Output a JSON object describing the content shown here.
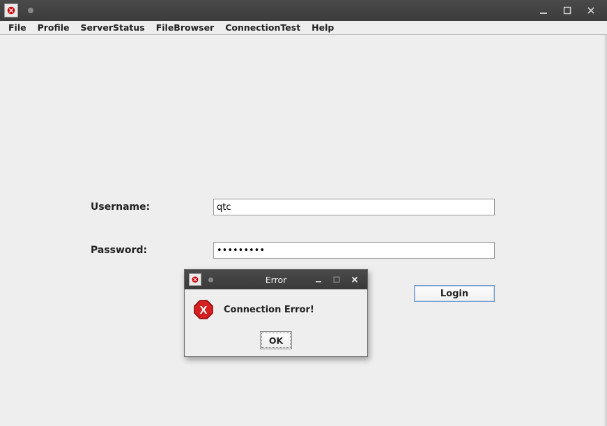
{
  "window": {
    "title": ""
  },
  "menubar": {
    "items": [
      "File",
      "Profile",
      "ServerStatus",
      "FileBrowser",
      "ConnectionTest",
      "Help"
    ]
  },
  "login": {
    "username_label": "Username:",
    "password_label": "Password:",
    "username_value": "qtc",
    "password_value": "•••••••••",
    "login_button": "Login"
  },
  "dialog": {
    "title": "Error",
    "message": "Connection Error!",
    "ok_button": "OK"
  }
}
